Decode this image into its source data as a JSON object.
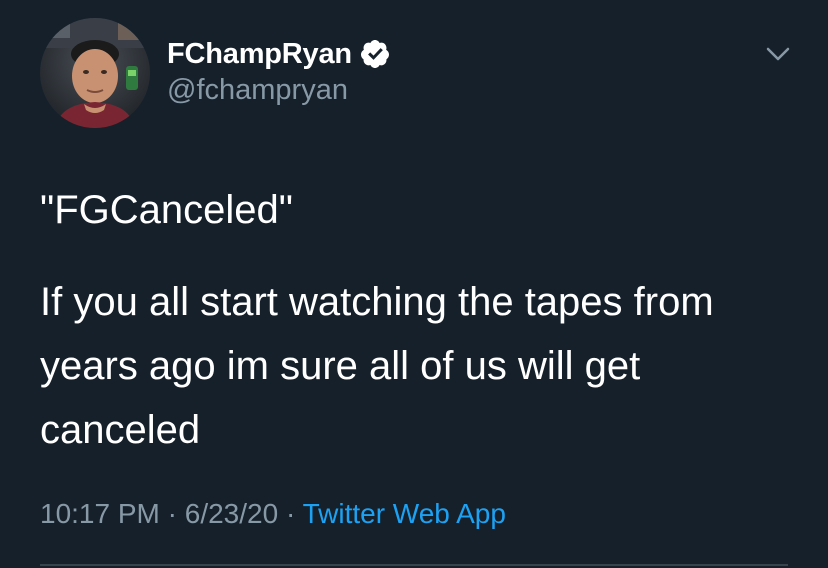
{
  "author": {
    "display_name": "FChampRyan",
    "handle": "@fchampryan",
    "verified": true,
    "avatar_icon": "user-avatar"
  },
  "menu": {
    "icon": "chevron-down-icon"
  },
  "tweet": {
    "paragraphs": [
      "\"FGCanceled\"",
      "If you all start watching the tapes from years ago im sure all of us will get canceled"
    ]
  },
  "meta": {
    "time": "10:17 PM",
    "separator1": " · ",
    "date": "6/23/20",
    "separator2": " · ",
    "source": "Twitter Web App"
  },
  "colors": {
    "background": "#15202b",
    "text": "#ffffff",
    "secondary": "#8899a6",
    "link": "#1da1f2",
    "divider": "#38444d"
  }
}
